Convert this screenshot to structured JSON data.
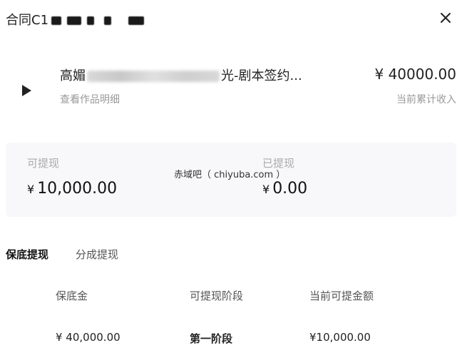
{
  "header": {
    "title": "合同C1"
  },
  "work": {
    "title_prefix": "高媚",
    "title_suffix": "光-剧本签约...",
    "detail_link": "查看作品明细",
    "income_amount": "¥ 40000.00",
    "income_label": "当前累计收入"
  },
  "stats": {
    "withdrawable_label": "可提现",
    "withdrawable_currency": "¥",
    "withdrawable_value": "10,000.00",
    "withdrawn_label": "已提现",
    "withdrawn_currency": "¥",
    "withdrawn_value": "0.00",
    "watermark": "赤域吧（ chiyuba.com ）"
  },
  "tabs": [
    {
      "label": "保底提现",
      "active": true
    },
    {
      "label": "分成提现",
      "active": false
    }
  ],
  "table": {
    "headers": [
      "保底金",
      "可提现阶段",
      "当前可提金额"
    ],
    "rows": [
      [
        "¥ 40,000.00",
        "第一阶段",
        "¥10,000.00"
      ]
    ]
  },
  "icons": {
    "close": "close-icon",
    "play": "play-icon"
  }
}
